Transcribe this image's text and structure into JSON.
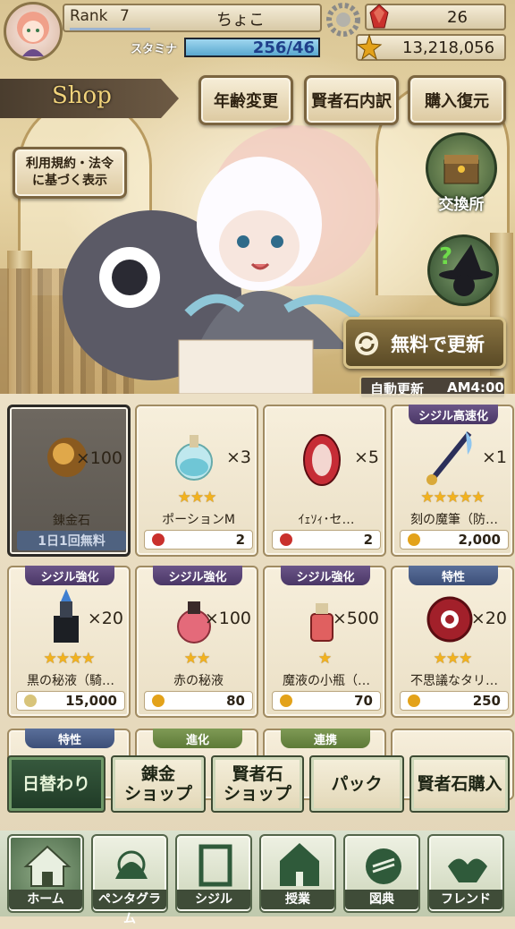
{
  "status_bar": {
    "rank_label": "Rank",
    "rank_value": "7",
    "player_name": "ちょこ",
    "stamina_label": "スタミナ",
    "stamina_value": "256/46",
    "stamina_fill": 1.0,
    "gem_count": "26",
    "gold_count": "13,218,056"
  },
  "header": {
    "shop_title": "Shop",
    "age_change_button": "年齢変更",
    "gem_breakdown_button": "賢者石内訳",
    "restore_purchase_button": "購入復元",
    "terms_button": "利用規約・法令\nに基づく表示",
    "exchange_label": "交換所",
    "free_refresh_button": "無料で更新",
    "auto_refresh_label": "自動更新",
    "auto_refresh_time": "AM4:00"
  },
  "items": [
    {
      "name": "錬金石",
      "qty": "×100",
      "badge": "",
      "stars": 0,
      "price": "",
      "currency": "",
      "free_label": "1日1回無料",
      "soldout": true
    },
    {
      "name": "ポーションM",
      "qty": "×3",
      "badge": "",
      "stars": 3,
      "price": "2",
      "currency": "gem"
    },
    {
      "name": "ｲｪｿｨ･セ…",
      "qty": "×5",
      "badge": "",
      "stars": 0,
      "price": "2",
      "currency": "gem"
    },
    {
      "name": "刻の魔筆（防…",
      "qty": "×1",
      "badge": "シジル高速化",
      "stars": 5,
      "price": "2,000",
      "currency": "gold"
    },
    {
      "name": "黒の秘液（騎…",
      "qty": "×20",
      "badge": "シジル強化",
      "stars": 4,
      "price": "15,000",
      "currency": "star"
    },
    {
      "name": "赤の秘液",
      "qty": "×100",
      "badge": "シジル強化",
      "stars": 2,
      "price": "80",
      "currency": "gold"
    },
    {
      "name": "魔液の小瓶（…",
      "qty": "×500",
      "badge": "シジル強化",
      "stars": 1,
      "price": "70",
      "currency": "gold"
    },
    {
      "name": "不思議なタリ…",
      "qty": "×20",
      "badge": "特性",
      "stars": 3,
      "price": "250",
      "currency": "gold"
    }
  ],
  "partial_badges": [
    "特性",
    "進化",
    "連携"
  ],
  "shop_tabs": [
    {
      "label": "日替わり",
      "active": true
    },
    {
      "label": "錬金\nショップ",
      "active": false
    },
    {
      "label": "賢者石\nショップ",
      "active": false
    },
    {
      "label": "パック",
      "active": false
    },
    {
      "label": "賢者石購入",
      "active": false
    }
  ],
  "nav": [
    {
      "label": "ホーム",
      "icon": "house-icon",
      "active": true
    },
    {
      "label": "ペンタグラム",
      "icon": "pentagram-icon",
      "active": false
    },
    {
      "label": "シジル",
      "icon": "sigil-frame-icon",
      "active": false
    },
    {
      "label": "授業",
      "icon": "school-icon",
      "active": false
    },
    {
      "label": "図典",
      "icon": "book-icon",
      "active": false
    },
    {
      "label": "フレンド",
      "icon": "handshake-icon",
      "active": false
    }
  ],
  "colors": {
    "gem": "#c9302c",
    "gold": "#e3a21a",
    "star_currency": "#d8c47a",
    "badge_purple": "#5a4577",
    "badge_green": "#6a8a45",
    "badge_blue": "#4a5f88",
    "tab_active": "#2b4a32"
  }
}
